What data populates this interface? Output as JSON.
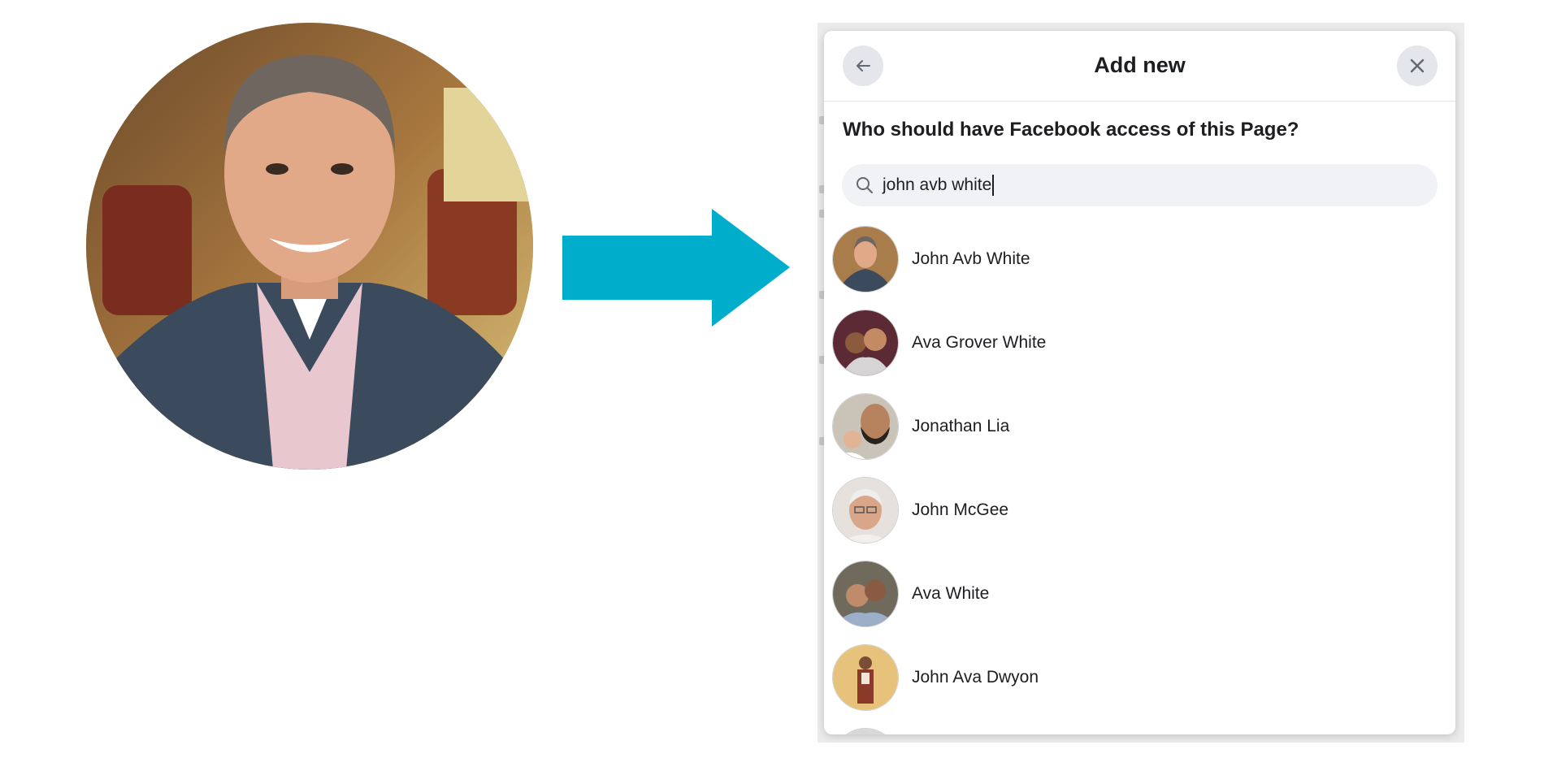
{
  "dialog": {
    "title": "Add new",
    "question": "Who should have Facebook access of this Page?",
    "search": {
      "value": "john avb white",
      "icon": "search-icon"
    },
    "back_icon": "arrow-left-icon",
    "close_icon": "close-icon"
  },
  "results": [
    {
      "name": "John Avb White"
    },
    {
      "name": "Ava Grover White"
    },
    {
      "name": "Jonathan Lia"
    },
    {
      "name": "John McGee"
    },
    {
      "name": "Ava White"
    },
    {
      "name": "John Ava Dwyon"
    }
  ],
  "colors": {
    "arrow": "#00aecb",
    "button_bg": "#e4e6eb",
    "search_bg": "#f0f2f5"
  }
}
